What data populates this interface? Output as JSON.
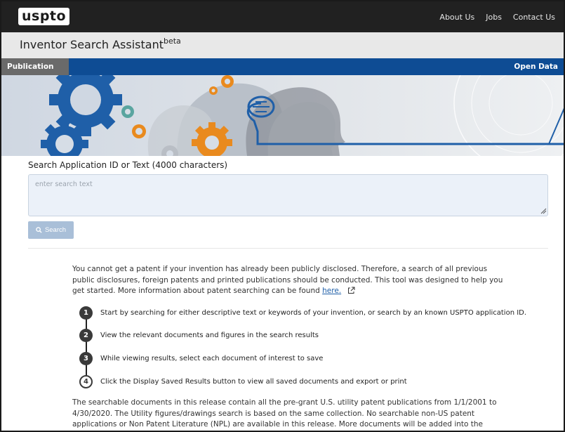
{
  "header": {
    "logo_text": "uspto",
    "links": [
      "About Us",
      "Jobs",
      "Contact Us"
    ]
  },
  "app": {
    "title": "Inventor Search Assistant",
    "title_sup": "beta"
  },
  "nav": {
    "active_tab": "Publication",
    "right_link": "Open Data"
  },
  "search": {
    "label": "Search Application ID or Text (4000 characters)",
    "placeholder": "enter search text",
    "value": "",
    "button_label": "Search"
  },
  "info": {
    "intro_text": "You cannot get a patent if your invention has already been publicly disclosed. Therefore, a search of all previous public disclosures, foreign patents and printed publications should be conducted. This tool was designed to help you get started. More information about patent searching can be found",
    "intro_link": "here.",
    "steps": [
      {
        "num": "1",
        "text": "Start by searching for either descriptive text or keywords of your invention, or search by an known USPTO application ID."
      },
      {
        "num": "2",
        "text": "View the relevant documents and figures in the search results"
      },
      {
        "num": "3",
        "text": "While viewing results, select each document of interest to save"
      },
      {
        "num": "4",
        "text": "Click the Display Saved Results button to view all saved documents and export or print"
      }
    ],
    "footer_text": "The searchable documents in this release contain all the pre-grant U.S. utility patent publications from 1/1/2001 to 4/30/2020. The Utility figures/drawings search is based on the same collection. No searchable non-US patent applications or Non Patent Literature (NPL) are available in this release. More documents will be added into the collection into future release."
  },
  "colors": {
    "topbar": "#212121",
    "navbar": "#0e4c94",
    "nav_tab": "#6a6a6a",
    "search_button": "#a9bfd8",
    "gear_blue": "#1f5fa8",
    "gear_orange": "#e98a1e",
    "gear_teal": "#5aa5a0"
  }
}
